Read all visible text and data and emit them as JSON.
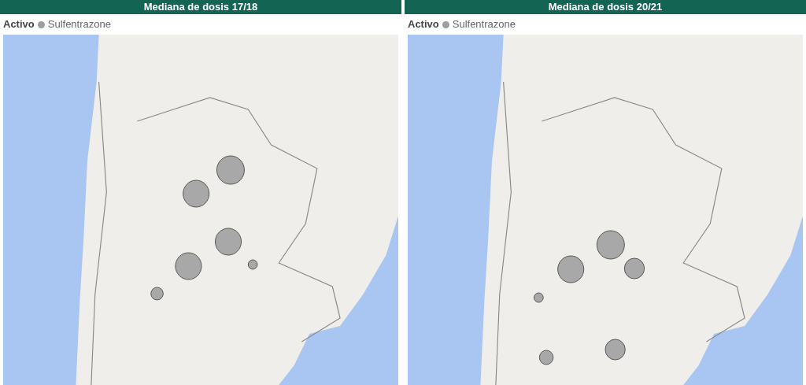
{
  "panels": [
    {
      "title": "Mediana de dosis 17/18",
      "legend": {
        "title": "Activo",
        "items": [
          {
            "label": "Sulfentrazone",
            "color": "#9e9e9e"
          }
        ]
      }
    },
    {
      "title": "Mediana de dosis 20/21",
      "legend": {
        "title": "Activo",
        "items": [
          {
            "label": "Sulfentrazone",
            "color": "#9e9e9e"
          }
        ]
      }
    }
  ]
}
